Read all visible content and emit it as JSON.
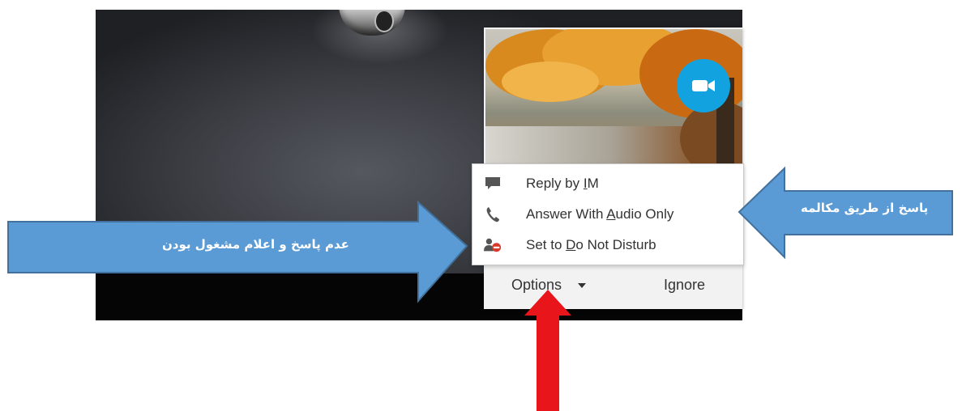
{
  "menu": {
    "items": [
      {
        "icon": "chat-icon",
        "pre": "Reply by ",
        "key": "I",
        "post": "M"
      },
      {
        "icon": "phone-icon",
        "pre": "Answer With ",
        "key": "A",
        "post": "udio Only"
      },
      {
        "icon": "do-not-disturb-icon",
        "pre": "Set to ",
        "key": "D",
        "post": "o Not Disturb"
      }
    ]
  },
  "bottom_bar": {
    "options_label": "Options",
    "ignore_label": "Ignore"
  },
  "annotations": {
    "left_arrow_text": "عدم پاسخ و اعلام  مشغول بودن",
    "right_arrow_text": "پاسخ از طریق مکالمه"
  },
  "colors": {
    "annotation_blue": "#5b9bd5",
    "annotation_border": "#41719c",
    "video_button": "#12a2e0",
    "pointer_red": "#e8161b"
  }
}
